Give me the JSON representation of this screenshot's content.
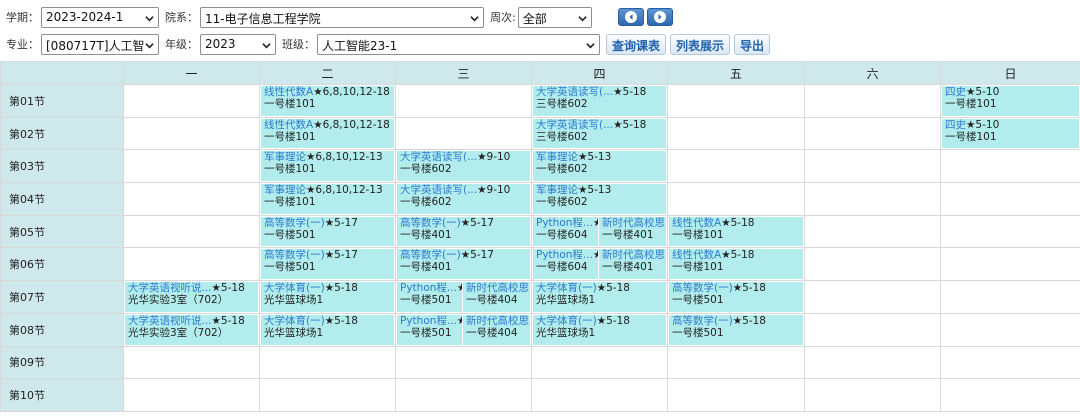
{
  "filters": {
    "term": {
      "label": "学期：",
      "value": "2023-2024-1"
    },
    "department": {
      "label": "院系：",
      "value": "11-电子信息工程学院"
    },
    "week": {
      "label": "周次:",
      "value": "全部"
    },
    "major": {
      "label": "专业：",
      "value": "[080717T]人工智"
    },
    "grade": {
      "label": "年级：",
      "value": "2023"
    },
    "class": {
      "label": "班级：",
      "value": "人工智能23-1"
    }
  },
  "buttons": {
    "query": "查询课表",
    "list_view": "列表展示",
    "export": "导出"
  },
  "colors": {
    "header_bg": "#cfe8ec",
    "course_bg": "#b2ecec",
    "course_name": "#2a7bd1",
    "nav_button": "#2e67ad"
  },
  "days": [
    "一",
    "二",
    "三",
    "四",
    "五",
    "六",
    "日"
  ],
  "periods": [
    {
      "label": "第01节",
      "cells": [
        [],
        [
          {
            "name": "线性代数A",
            "weeks": "★6,8,10,12-18",
            "room": "一号楼101"
          }
        ],
        [],
        [
          {
            "name": "大学英语读写(...",
            "weeks": "★5-18",
            "room": "三号楼602"
          }
        ],
        [],
        [],
        [
          {
            "name": "四史",
            "weeks": "★5-10",
            "room": "一号楼101"
          }
        ]
      ]
    },
    {
      "label": "第02节",
      "cells": [
        [],
        [
          {
            "name": "线性代数A",
            "weeks": "★6,8,10,12-18",
            "room": "一号楼101"
          }
        ],
        [],
        [
          {
            "name": "大学英语读写(...",
            "weeks": "★5-18",
            "room": "三号楼602"
          }
        ],
        [],
        [],
        [
          {
            "name": "四史",
            "weeks": "★5-10",
            "room": "一号楼101"
          }
        ]
      ]
    },
    {
      "label": "第03节",
      "cells": [
        [],
        [
          {
            "name": "军事理论",
            "weeks": "★6,8,10,12-13",
            "room": "一号楼101"
          }
        ],
        [
          {
            "name": "大学英语读写(...",
            "weeks": "★9-10",
            "room": "一号楼602"
          }
        ],
        [
          {
            "name": "军事理论",
            "weeks": "★5-13",
            "room": "一号楼602"
          }
        ],
        [],
        [],
        []
      ]
    },
    {
      "label": "第04节",
      "cells": [
        [],
        [
          {
            "name": "军事理论",
            "weeks": "★6,8,10,12-13",
            "room": "一号楼101"
          }
        ],
        [
          {
            "name": "大学英语读写(...",
            "weeks": "★9-10",
            "room": "一号楼602"
          }
        ],
        [
          {
            "name": "军事理论",
            "weeks": "★5-13",
            "room": "一号楼602"
          }
        ],
        [],
        [],
        []
      ]
    },
    {
      "label": "第05节",
      "cells": [
        [],
        [
          {
            "name": "高等数学(一)",
            "weeks": "★5-17",
            "room": "一号楼501"
          }
        ],
        [
          {
            "name": "高等数学(一)",
            "weeks": "★5-17",
            "room": "一号楼401"
          }
        ],
        [
          {
            "name": "Python程...",
            "weeks": "★",
            "room": "一号楼604"
          },
          {
            "name": "新时代高校思",
            "weeks": "",
            "room": "一号楼401"
          }
        ],
        [
          {
            "name": "线性代数A",
            "weeks": "★5-18",
            "room": "一号楼101"
          }
        ],
        [],
        []
      ]
    },
    {
      "label": "第06节",
      "cells": [
        [],
        [
          {
            "name": "高等数学(一)",
            "weeks": "★5-17",
            "room": "一号楼501"
          }
        ],
        [
          {
            "name": "高等数学(一)",
            "weeks": "★5-17",
            "room": "一号楼401"
          }
        ],
        [
          {
            "name": "Python程...",
            "weeks": "★",
            "room": "一号楼604"
          },
          {
            "name": "新时代高校思",
            "weeks": "",
            "room": "一号楼401"
          }
        ],
        [
          {
            "name": "线性代数A",
            "weeks": "★5-18",
            "room": "一号楼101"
          }
        ],
        [],
        []
      ]
    },
    {
      "label": "第07节",
      "cells": [
        [
          {
            "name": "大学英语视听说...",
            "weeks": "★5-18",
            "room": "光华实验3室（702）"
          }
        ],
        [
          {
            "name": "大学体育(一)",
            "weeks": "★5-18",
            "room": "光华篮球场1"
          }
        ],
        [
          {
            "name": "Python程...",
            "weeks": "★",
            "room": "一号楼501"
          },
          {
            "name": "新时代高校思",
            "weeks": "",
            "room": "一号楼404"
          }
        ],
        [
          {
            "name": "大学体育(一)",
            "weeks": "★5-18",
            "room": "光华篮球场1"
          }
        ],
        [
          {
            "name": "高等数学(一)",
            "weeks": "★5-18",
            "room": "一号楼501"
          }
        ],
        [],
        []
      ]
    },
    {
      "label": "第08节",
      "cells": [
        [
          {
            "name": "大学英语视听说...",
            "weeks": "★5-18",
            "room": "光华实验3室（702）"
          }
        ],
        [
          {
            "name": "大学体育(一)",
            "weeks": "★5-18",
            "room": "光华篮球场1"
          }
        ],
        [
          {
            "name": "Python程...",
            "weeks": "★",
            "room": "一号楼501"
          },
          {
            "name": "新时代高校思",
            "weeks": "",
            "room": "一号楼404"
          }
        ],
        [
          {
            "name": "大学体育(一)",
            "weeks": "★5-18",
            "room": "光华篮球场1"
          }
        ],
        [
          {
            "name": "高等数学(一)",
            "weeks": "★5-18",
            "room": "一号楼501"
          }
        ],
        [],
        []
      ]
    },
    {
      "label": "第09节",
      "cells": [
        [],
        [],
        [],
        [],
        [],
        [],
        []
      ]
    },
    {
      "label": "第10节",
      "cells": [
        [],
        [],
        [],
        [],
        [],
        [],
        []
      ]
    }
  ]
}
